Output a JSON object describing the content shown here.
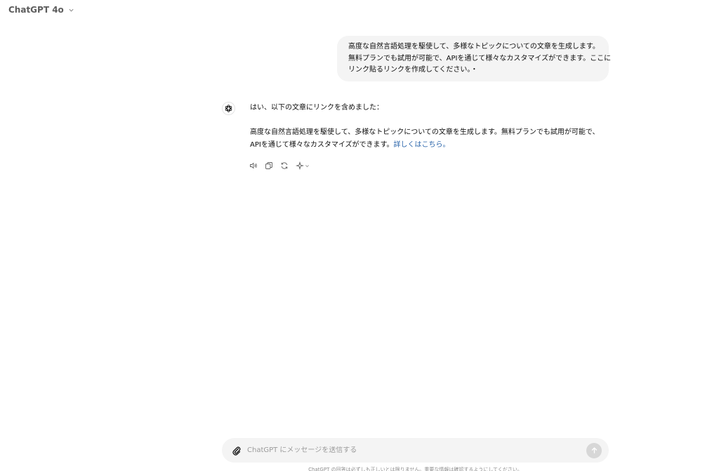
{
  "header": {
    "model_name": "ChatGPT 4o"
  },
  "conversation": {
    "user_message": {
      "lines": [
        "高度な自然言語処理を駆使して、多様なトピックについての文章を生成します。",
        "無料プランでも試用が可能で、APIを通じて様々なカスタマイズができます。ここに",
        "リンク貼るリンクを作成してください。・"
      ]
    },
    "assistant_message": {
      "intro": "はい、以下の文章にリンクを含めました：",
      "body_line1": "高度な自然言語処理を駆使して、多様なトピックについての文章を生成します。無料プランでも試用が可能で、",
      "body_line2": "APIを通じて様々なカスタマイズができます。",
      "link_text": "詳しくはこちら。"
    },
    "action_icons": [
      "speaker-icon",
      "copy-icon",
      "regenerate-icon",
      "sparkle-icon"
    ]
  },
  "composer": {
    "placeholder": "ChatGPT にメッセージを送信する"
  },
  "footer": {
    "disclaimer": "ChatGPT の回答は必ずしも正しいとは限りません。重要な情報は確認するようにしてください。"
  },
  "colors": {
    "bubble_bg": "#f4f4f4",
    "link": "#2964aa",
    "send_button_disabled": "#d7d7d7"
  }
}
